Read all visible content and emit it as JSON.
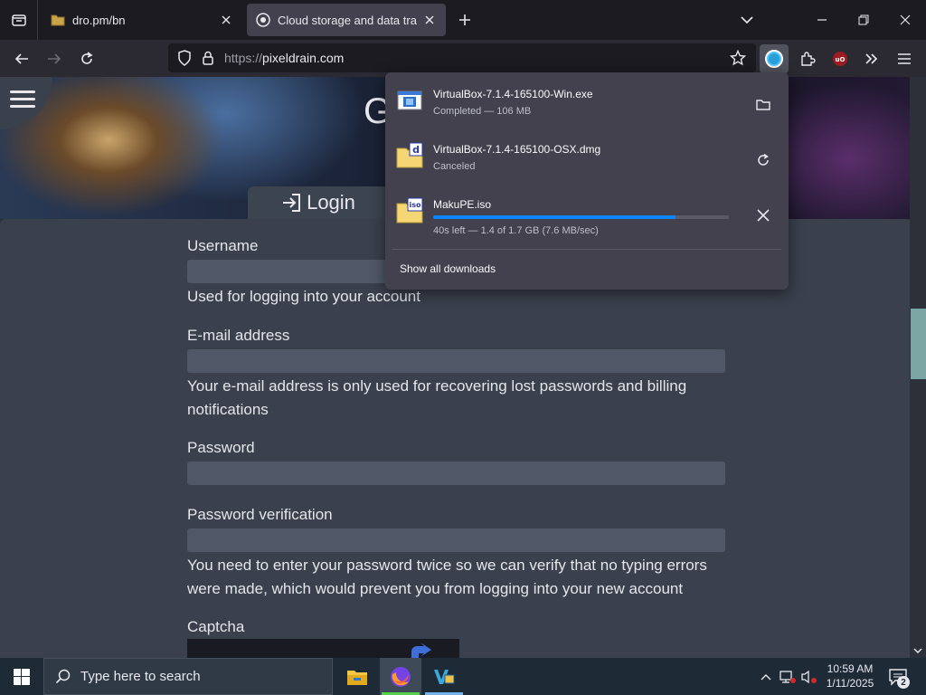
{
  "browser": {
    "tabs": [
      {
        "title": "dro.pm/bn",
        "active": false
      },
      {
        "title": "Cloud storage and data transfer",
        "active": true
      }
    ],
    "url": {
      "scheme": "https://",
      "host": "pixeldrain.com"
    }
  },
  "page": {
    "banner_letter": "G",
    "login_tab_label": "Login",
    "form": {
      "username_label": "Username",
      "username_help": "Used for logging into your account",
      "email_label": "E-mail address",
      "email_help": "Your e-mail address is only used for recovering lost passwords and billing notifications",
      "password_label": "Password",
      "password_verify_label": "Password verification",
      "password_help": "You need to enter your password twice so we can verify that no typing errors were made, which would prevent you from logging into your new account",
      "captcha_label": "Captcha"
    }
  },
  "downloads": {
    "items": [
      {
        "name": "VirtualBox-7.1.4-165100-Win.exe",
        "status": "Completed — 106 MB",
        "action_icon": "folder-icon"
      },
      {
        "name": "VirtualBox-7.1.4-165100-OSX.dmg",
        "status": "Canceled",
        "action_icon": "retry-icon",
        "file_icon_letter": "d"
      },
      {
        "name": "MakuPE.iso",
        "status": "40s left — 1.4 of 1.7 GB (7.6 MB/sec)",
        "action_icon": "cancel-icon",
        "file_icon_letter": "iso",
        "progress": 0.82
      }
    ],
    "show_all_label": "Show all downloads"
  },
  "taskbar": {
    "search_placeholder": "Type here to search",
    "time": "10:59 AM",
    "date": "1/11/2025",
    "notification_count": "2"
  },
  "colors": {
    "accent_blue": "#0a84ff",
    "form_panel": "#3a404c",
    "input_bg": "#505868",
    "scroll_thumb": "#7aa7a3"
  }
}
